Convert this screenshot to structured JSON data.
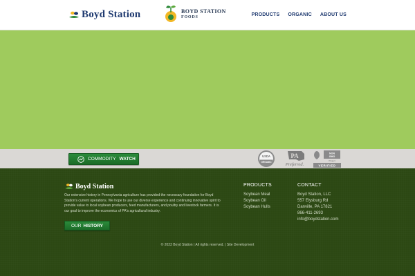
{
  "header": {
    "logo_text": "Boyd Station",
    "foods_logo_line1": "BOYD STATION",
    "foods_logo_line2": "FOODS",
    "nav": [
      "PRODUCTS",
      "ORGANIC",
      "ABOUT US"
    ]
  },
  "bar": {
    "commodity_part1": "COMMODITY",
    "commodity_part2": "WATCH",
    "badges": {
      "usda": "USDA ORGANIC",
      "pa": "PA Preferred",
      "gmo_top": "NON GMO",
      "gmo_mid": "Project",
      "gmo_bottom": "VERIFIED"
    }
  },
  "footer": {
    "logo_text": "Boyd Station",
    "about": "Our extensive history in Pennsylvania agriculture has provided the necessary foundation for Boyd Station's current operations. We hope to use our diverse experience and continuing innovative spirit to provide value to local soybean producers, feed manufacturers, and poultry and livestock farmers. It is our goal to improve the economics of PA's agricultural industry.",
    "history_part1": "OUR",
    "history_part2": "HISTORY",
    "products": {
      "heading": "PRODUCTS",
      "items": [
        "Soybean Meal",
        "Soybean Oil",
        "Soybean Hulls"
      ]
    },
    "contact": {
      "heading": "CONTACT",
      "lines": [
        "Boyd Station, LLC",
        "557 Elysburg Rd",
        "Danville, PA 17821",
        "866-411-2693",
        "info@boydstation.com"
      ]
    },
    "copyright": "© 2023 Boyd Station | All rights reserved. |",
    "site_dev": "Site Development"
  },
  "colors": {
    "navy": "#1f3a70",
    "hero_green": "#9fcb5d",
    "bar_gray": "#dad8d5",
    "button_green": "#1c6c28",
    "footer_green": "#2c4813"
  }
}
